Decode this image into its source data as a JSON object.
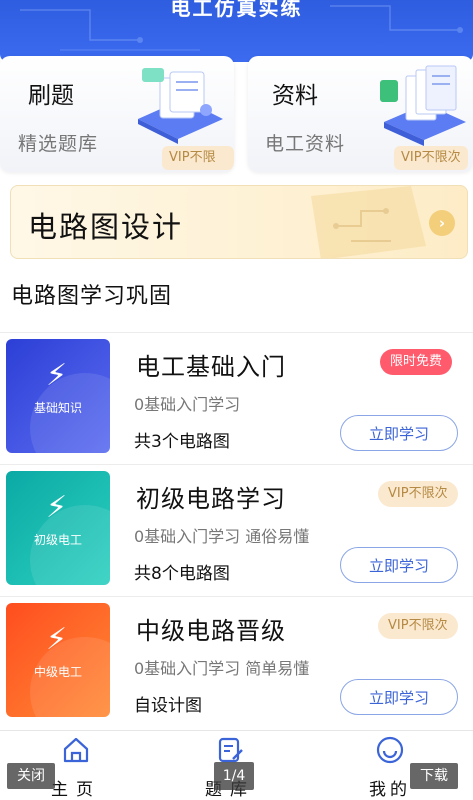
{
  "header": {
    "title": "电工仿真实练"
  },
  "cards": [
    {
      "title": "刷题",
      "subtitle": "精选题库",
      "tag": "VIP不限次"
    },
    {
      "title": "资料",
      "subtitle": "电工资料",
      "tag": "VIP不限次"
    }
  ],
  "banner": {
    "title": "电路图设计",
    "arrow_icon": "chevron-right-icon"
  },
  "section": {
    "title": "电路图学习巩固"
  },
  "courses": [
    {
      "thumb_label": "基础知识",
      "title": "电工基础入门",
      "desc": "0基础入门学习",
      "count": "共3个电路图",
      "tag": "限时免费",
      "button": "立即学习",
      "color": "#2c3fd6"
    },
    {
      "thumb_label": "初级电工",
      "title": "初级电路学习",
      "desc": "0基础入门学习 通俗易懂",
      "count": "共8个电路图",
      "tag": "VIP不限次",
      "button": "立即学习",
      "color": "#0ba9a4"
    },
    {
      "thumb_label": "中级电工",
      "title": "中级电路晋级",
      "desc": "0基础入门学习 简单易懂",
      "count": "自设计图",
      "tag": "VIP不限次",
      "button": "立即学习",
      "color": "#ff4d1f"
    }
  ],
  "bottom_nav": [
    {
      "label": "主页",
      "icon": "home-icon"
    },
    {
      "label": "题库",
      "icon": "edit-icon"
    },
    {
      "label": "我的",
      "icon": "user-icon"
    }
  ],
  "overlay": {
    "close": "关闭",
    "page": "1/4",
    "download": "下载"
  }
}
